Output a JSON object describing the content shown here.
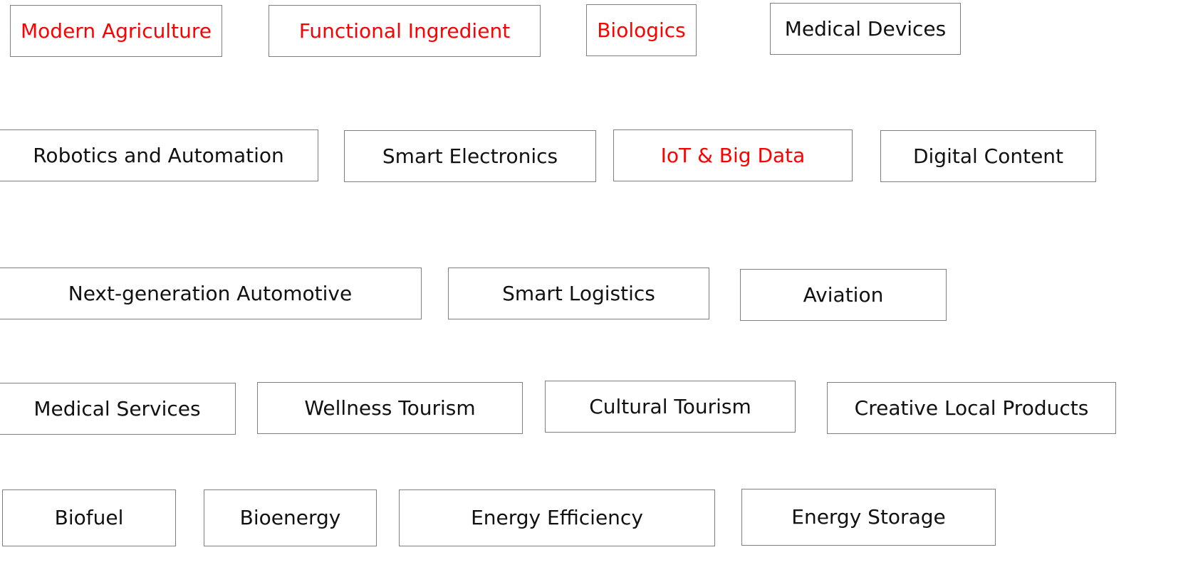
{
  "colors": {
    "highlight_text": "#ff0000",
    "normal_text": "#111111",
    "box_border": "#7f7f7f",
    "background": "#ffffff"
  },
  "boxes": [
    {
      "label": "Modern Agriculture",
      "highlighted": true
    },
    {
      "label": "Functional Ingredient",
      "highlighted": true
    },
    {
      "label": "Biologics",
      "highlighted": true
    },
    {
      "label": "Medical Devices",
      "highlighted": false
    },
    {
      "label": "Robotics and Automation",
      "highlighted": false
    },
    {
      "label": "Smart Electronics",
      "highlighted": false
    },
    {
      "label": "IoT & Big Data",
      "highlighted": true
    },
    {
      "label": "Digital Content",
      "highlighted": false
    },
    {
      "label": "Next-generation Automotive",
      "highlighted": false
    },
    {
      "label": "Smart Logistics",
      "highlighted": false
    },
    {
      "label": "Aviation",
      "highlighted": false
    },
    {
      "label": "Medical Services",
      "highlighted": false
    },
    {
      "label": "Wellness Tourism",
      "highlighted": false
    },
    {
      "label": "Cultural Tourism",
      "highlighted": false
    },
    {
      "label": "Creative Local Products",
      "highlighted": false
    },
    {
      "label": "Biofuel",
      "highlighted": false
    },
    {
      "label": "Bioenergy",
      "highlighted": false
    },
    {
      "label": "Energy Efficiency",
      "highlighted": false
    },
    {
      "label": "Energy Storage",
      "highlighted": false
    }
  ]
}
